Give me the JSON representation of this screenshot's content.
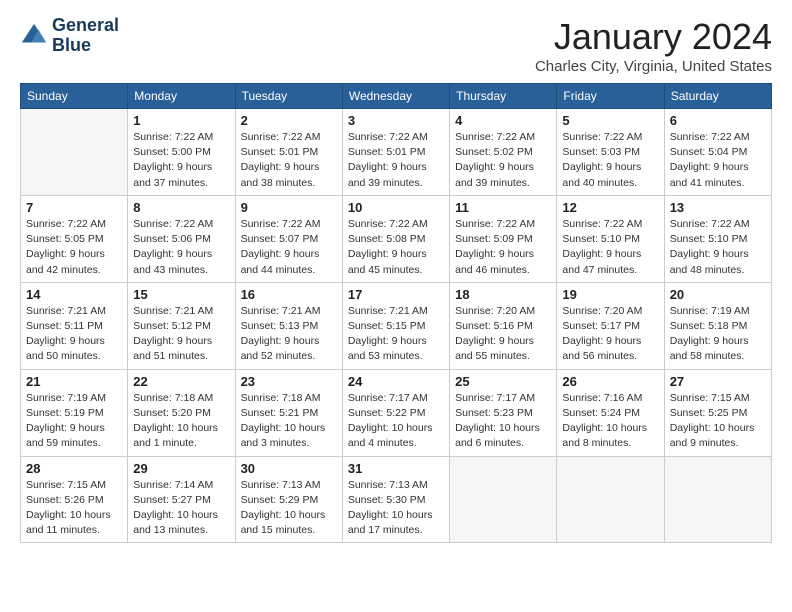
{
  "header": {
    "logo_line1": "General",
    "logo_line2": "Blue",
    "month": "January 2024",
    "location": "Charles City, Virginia, United States"
  },
  "weekdays": [
    "Sunday",
    "Monday",
    "Tuesday",
    "Wednesday",
    "Thursday",
    "Friday",
    "Saturday"
  ],
  "weeks": [
    [
      {
        "day": "",
        "info": ""
      },
      {
        "day": "1",
        "info": "Sunrise: 7:22 AM\nSunset: 5:00 PM\nDaylight: 9 hours\nand 37 minutes."
      },
      {
        "day": "2",
        "info": "Sunrise: 7:22 AM\nSunset: 5:01 PM\nDaylight: 9 hours\nand 38 minutes."
      },
      {
        "day": "3",
        "info": "Sunrise: 7:22 AM\nSunset: 5:01 PM\nDaylight: 9 hours\nand 39 minutes."
      },
      {
        "day": "4",
        "info": "Sunrise: 7:22 AM\nSunset: 5:02 PM\nDaylight: 9 hours\nand 39 minutes."
      },
      {
        "day": "5",
        "info": "Sunrise: 7:22 AM\nSunset: 5:03 PM\nDaylight: 9 hours\nand 40 minutes."
      },
      {
        "day": "6",
        "info": "Sunrise: 7:22 AM\nSunset: 5:04 PM\nDaylight: 9 hours\nand 41 minutes."
      }
    ],
    [
      {
        "day": "7",
        "info": "Sunrise: 7:22 AM\nSunset: 5:05 PM\nDaylight: 9 hours\nand 42 minutes."
      },
      {
        "day": "8",
        "info": "Sunrise: 7:22 AM\nSunset: 5:06 PM\nDaylight: 9 hours\nand 43 minutes."
      },
      {
        "day": "9",
        "info": "Sunrise: 7:22 AM\nSunset: 5:07 PM\nDaylight: 9 hours\nand 44 minutes."
      },
      {
        "day": "10",
        "info": "Sunrise: 7:22 AM\nSunset: 5:08 PM\nDaylight: 9 hours\nand 45 minutes."
      },
      {
        "day": "11",
        "info": "Sunrise: 7:22 AM\nSunset: 5:09 PM\nDaylight: 9 hours\nand 46 minutes."
      },
      {
        "day": "12",
        "info": "Sunrise: 7:22 AM\nSunset: 5:10 PM\nDaylight: 9 hours\nand 47 minutes."
      },
      {
        "day": "13",
        "info": "Sunrise: 7:22 AM\nSunset: 5:10 PM\nDaylight: 9 hours\nand 48 minutes."
      }
    ],
    [
      {
        "day": "14",
        "info": "Sunrise: 7:21 AM\nSunset: 5:11 PM\nDaylight: 9 hours\nand 50 minutes."
      },
      {
        "day": "15",
        "info": "Sunrise: 7:21 AM\nSunset: 5:12 PM\nDaylight: 9 hours\nand 51 minutes."
      },
      {
        "day": "16",
        "info": "Sunrise: 7:21 AM\nSunset: 5:13 PM\nDaylight: 9 hours\nand 52 minutes."
      },
      {
        "day": "17",
        "info": "Sunrise: 7:21 AM\nSunset: 5:15 PM\nDaylight: 9 hours\nand 53 minutes."
      },
      {
        "day": "18",
        "info": "Sunrise: 7:20 AM\nSunset: 5:16 PM\nDaylight: 9 hours\nand 55 minutes."
      },
      {
        "day": "19",
        "info": "Sunrise: 7:20 AM\nSunset: 5:17 PM\nDaylight: 9 hours\nand 56 minutes."
      },
      {
        "day": "20",
        "info": "Sunrise: 7:19 AM\nSunset: 5:18 PM\nDaylight: 9 hours\nand 58 minutes."
      }
    ],
    [
      {
        "day": "21",
        "info": "Sunrise: 7:19 AM\nSunset: 5:19 PM\nDaylight: 9 hours\nand 59 minutes."
      },
      {
        "day": "22",
        "info": "Sunrise: 7:18 AM\nSunset: 5:20 PM\nDaylight: 10 hours\nand 1 minute."
      },
      {
        "day": "23",
        "info": "Sunrise: 7:18 AM\nSunset: 5:21 PM\nDaylight: 10 hours\nand 3 minutes."
      },
      {
        "day": "24",
        "info": "Sunrise: 7:17 AM\nSunset: 5:22 PM\nDaylight: 10 hours\nand 4 minutes."
      },
      {
        "day": "25",
        "info": "Sunrise: 7:17 AM\nSunset: 5:23 PM\nDaylight: 10 hours\nand 6 minutes."
      },
      {
        "day": "26",
        "info": "Sunrise: 7:16 AM\nSunset: 5:24 PM\nDaylight: 10 hours\nand 8 minutes."
      },
      {
        "day": "27",
        "info": "Sunrise: 7:15 AM\nSunset: 5:25 PM\nDaylight: 10 hours\nand 9 minutes."
      }
    ],
    [
      {
        "day": "28",
        "info": "Sunrise: 7:15 AM\nSunset: 5:26 PM\nDaylight: 10 hours\nand 11 minutes."
      },
      {
        "day": "29",
        "info": "Sunrise: 7:14 AM\nSunset: 5:27 PM\nDaylight: 10 hours\nand 13 minutes."
      },
      {
        "day": "30",
        "info": "Sunrise: 7:13 AM\nSunset: 5:29 PM\nDaylight: 10 hours\nand 15 minutes."
      },
      {
        "day": "31",
        "info": "Sunrise: 7:13 AM\nSunset: 5:30 PM\nDaylight: 10 hours\nand 17 minutes."
      },
      {
        "day": "",
        "info": ""
      },
      {
        "day": "",
        "info": ""
      },
      {
        "day": "",
        "info": ""
      }
    ]
  ]
}
